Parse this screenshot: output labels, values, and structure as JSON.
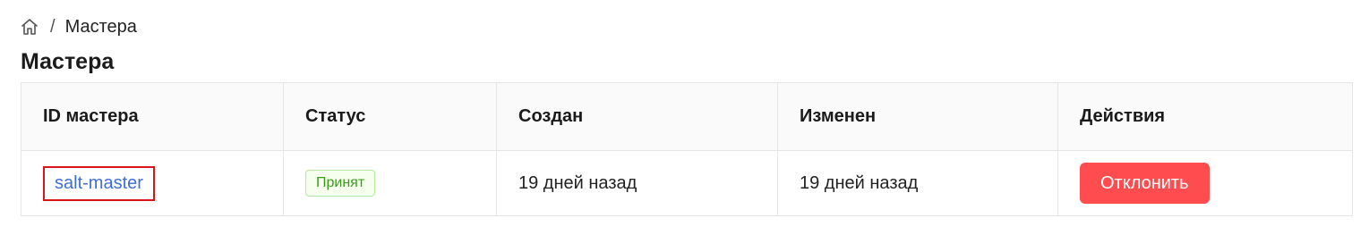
{
  "breadcrumb": {
    "home_icon": "home-icon",
    "separator": "/",
    "current": "Мастера"
  },
  "page_title": "Мастера",
  "table": {
    "columns": [
      "ID мастера",
      "Статус",
      "Создан",
      "Изменен",
      "Действия"
    ],
    "rows": [
      {
        "id": "salt-master",
        "status": "Принят",
        "created": "19 дней назад",
        "modified": "19 дней назад",
        "action": "Отклонить"
      }
    ]
  },
  "colors": {
    "link": "#3e6fd8",
    "highlight_border": "#d9141c",
    "status_bg": "#f6ffed",
    "status_text": "#3b9a1a",
    "danger": "#ff4d4f"
  }
}
